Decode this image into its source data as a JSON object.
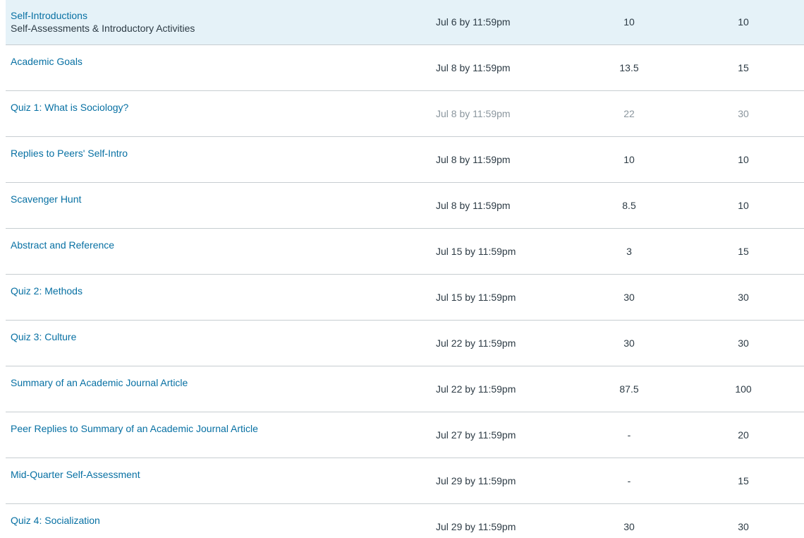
{
  "assignments": [
    {
      "name": "Self-Introductions",
      "context": "Self-Assessments & Introductory Activities",
      "due": "Jul 6 by 11:59pm",
      "score": "10",
      "possible": "10"
    },
    {
      "name": "Academic Goals",
      "due": "Jul 8 by 11:59pm",
      "score": "13.5",
      "possible": "15"
    },
    {
      "name": "Quiz 1: What is Sociology?",
      "due": "Jul 8 by 11:59pm",
      "score": "22",
      "possible": "30"
    },
    {
      "name": "Replies to Peers' Self-Intro",
      "due": "Jul 8 by 11:59pm",
      "score": "10",
      "possible": "10"
    },
    {
      "name": "Scavenger Hunt",
      "due": "Jul 8 by 11:59pm",
      "score": "8.5",
      "possible": "10"
    },
    {
      "name": "Abstract and Reference",
      "due": "Jul 15 by 11:59pm",
      "score": "3",
      "possible": "15"
    },
    {
      "name": "Quiz 2: Methods",
      "due": "Jul 15 by 11:59pm",
      "score": "30",
      "possible": "30"
    },
    {
      "name": "Quiz 3: Culture",
      "due": "Jul 22 by 11:59pm",
      "score": "30",
      "possible": "30"
    },
    {
      "name": "Summary of an Academic Journal Article",
      "due": "Jul 22 by 11:59pm",
      "score": "87.5",
      "possible": "100"
    },
    {
      "name": "Peer Replies to Summary of an Academic Journal Article",
      "due": "Jul 27 by 11:59pm",
      "score": "-",
      "possible": "20"
    },
    {
      "name": "Mid-Quarter Self-Assessment",
      "due": "Jul 29 by 11:59pm",
      "score": "-",
      "possible": "15"
    },
    {
      "name": "Quiz 4: Socialization",
      "due": "Jul 29 by 11:59pm",
      "score": "30",
      "possible": "30"
    }
  ],
  "colors": {
    "link": "#0770a3",
    "text": "#2d3b45",
    "muted": "#8b969e",
    "highlight_row": "#e5f2f8",
    "divider": "#c7cdd1"
  }
}
